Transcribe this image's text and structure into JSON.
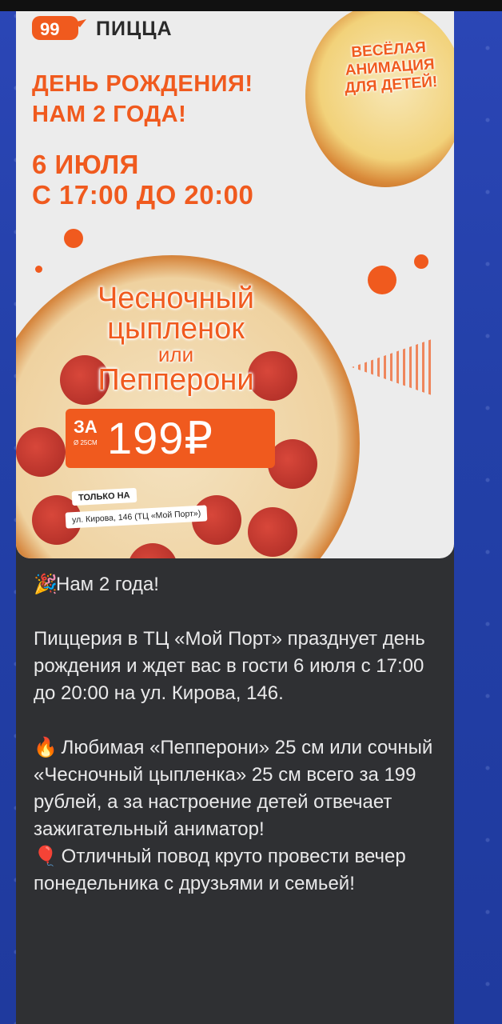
{
  "promo": {
    "brand": "ПИЦЦА",
    "headline_1": "ДЕНЬ РОЖДЕНИЯ!",
    "headline_2": "НАМ 2 ГОДА!",
    "date": "6 ИЮЛЯ",
    "time": "С 17:00 ДО 20:00",
    "badge_lines": [
      "ВЕСЁЛАЯ",
      "АНИМАЦИЯ",
      "ДЛЯ ДЕТЕЙ!"
    ],
    "pizza_name_1a": "Чесночный",
    "pizza_name_1b": "цыпленок",
    "pizza_or": "или",
    "pizza_name_2": "Пепперони",
    "price_prefix": "ЗА",
    "price_size": "Ø 25СМ",
    "price": "199₽",
    "only_at": "ТОЛЬКО НА",
    "address": "ул. Кирова, 146 (ТЦ «Мой Порт»)",
    "accent_color": "#f05a1e"
  },
  "message": {
    "line_title_emoji": "🎉",
    "line_title": "Нам 2 года!",
    "paragraph_1": "Пиццерия в ТЦ «Мой Порт» празднует день рождения и ждет вас в гости 6 июля с 17:00 до 20:00 на ул. Кирова, 146.",
    "fire_emoji": "🔥",
    "paragraph_2": "Любимая «Пепперони» 25 см или сочный «Чесночный цыпленка» 25 см всего за 199 рублей, а за настроение детей отвечает зажигательный аниматор!",
    "balloon_emoji": "🎈",
    "paragraph_3": "Отличный повод круто провести вечер понедельника с друзьями и семьей!"
  }
}
